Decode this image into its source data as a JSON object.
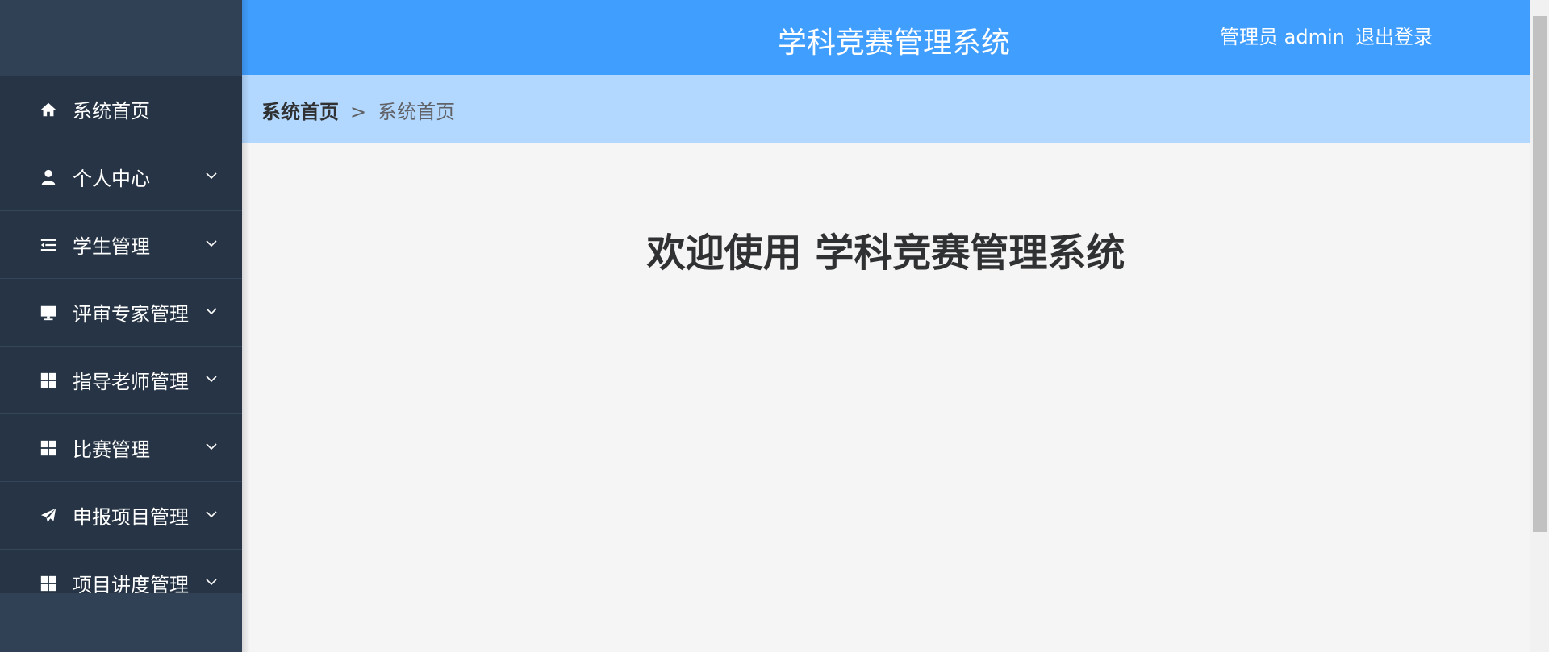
{
  "app": {
    "title": "学科竞赛管理系统"
  },
  "header": {
    "title": "学科竞赛管理系统",
    "user_label": "管理员 admin",
    "logout_label": "退出登录"
  },
  "sidebar": {
    "items": [
      {
        "label": "系统首页",
        "icon": "home-icon",
        "expandable": false
      },
      {
        "label": "个人中心",
        "icon": "user-icon",
        "expandable": true
      },
      {
        "label": "学生管理",
        "icon": "list-icon",
        "expandable": true
      },
      {
        "label": "评审专家管理",
        "icon": "monitor-icon",
        "expandable": true
      },
      {
        "label": "指导老师管理",
        "icon": "grid-icon",
        "expandable": true
      },
      {
        "label": "比赛管理",
        "icon": "grid-icon",
        "expandable": true
      },
      {
        "label": "申报项目管理",
        "icon": "paper-plane-icon",
        "expandable": true
      },
      {
        "label": "项目讲度管理",
        "icon": "grid-icon",
        "expandable": true
      }
    ]
  },
  "breadcrumb": {
    "root": "系统首页",
    "separator": ">",
    "current": "系统首页"
  },
  "main": {
    "welcome_text": "欢迎使用 学科竞赛管理系统"
  },
  "colors": {
    "sidebar_bg": "#304156",
    "sidebar_menu_bg": "#263445",
    "header_bg": "#409eff",
    "breadcrumb_bg": "#b3d8ff",
    "main_bg": "#f5f5f5"
  }
}
